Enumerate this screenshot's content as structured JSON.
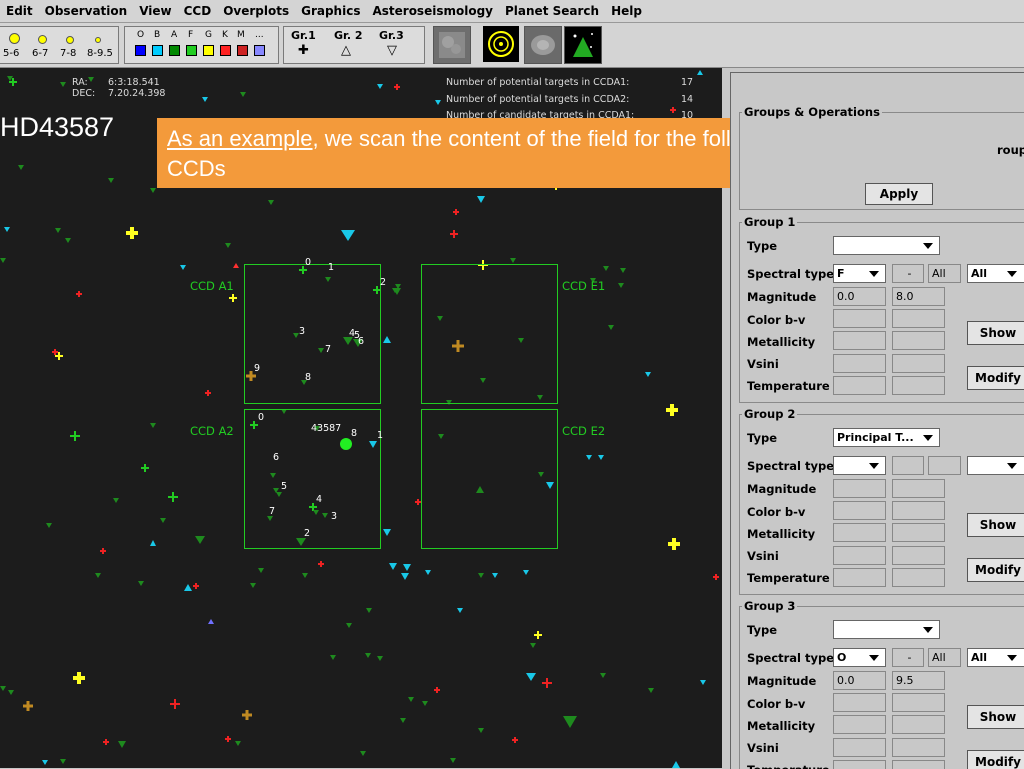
{
  "menubar": {
    "items": [
      "Edit",
      "Observation",
      "View",
      "CCD",
      "Overplots",
      "Graphics",
      "Asteroseismology",
      "Planet Search",
      "Help"
    ]
  },
  "toolbar": {
    "magnitudes": [
      "5-6",
      "6-7",
      "7-8",
      "8-9.5"
    ],
    "spectral_types": [
      "O",
      "B",
      "A",
      "F",
      "G",
      "K",
      "M",
      "..."
    ],
    "spectral_colors": [
      "#0000ff",
      "#00ccff",
      "#00aa00",
      "#22cc22",
      "#ffff00",
      "#ff2222",
      "#cc2222",
      "#8888ff"
    ],
    "groups": [
      {
        "label": "Gr.1",
        "symbol": "✚"
      },
      {
        "label": "Gr. 2",
        "symbol": "△"
      },
      {
        "label": "Gr.3",
        "symbol": "▽"
      }
    ],
    "icons": [
      "sky-image-icon",
      "circle-target-icon",
      "galaxy-icon",
      "star-field-icon"
    ]
  },
  "sky": {
    "ra_label": "RA:",
    "ra_value": "6:3:18.541",
    "dec_label": "DEC:",
    "dec_value": "7.20.24.398",
    "stats": [
      {
        "label": "Number of potential targets in CCDA1:",
        "value": "17"
      },
      {
        "label": "Number of potential targets in CCDA2:",
        "value": "14"
      },
      {
        "label": "Number of candidate targets in CCDA1:",
        "value": "10"
      }
    ],
    "star_name": "HD43587",
    "target_id": "43587",
    "ccds": [
      {
        "id": "a1",
        "label": "CCD A1"
      },
      {
        "id": "a2",
        "label": "CCD A2"
      },
      {
        "id": "e1",
        "label": "CCD E1"
      },
      {
        "id": "e2",
        "label": "CCD E2"
      }
    ],
    "ccd_a1_numbers": [
      "0",
      "1",
      "2",
      "3",
      "4",
      "5",
      "6",
      "7",
      "8",
      "9"
    ],
    "ccd_a2_numbers": [
      "0",
      "1",
      "2",
      "3",
      "4",
      "5",
      "6",
      "7",
      "8"
    ]
  },
  "callout": {
    "link_text": "As an example",
    "rest_text": ", we scan the content of the field for the following position of the CCDs"
  },
  "panel": {
    "groups_ops": {
      "title": "Groups & Operations",
      "group_text": "roup",
      "apply_label": "Apply"
    },
    "labels": {
      "type": "Type",
      "spectral_type": "Spectral type",
      "magnitude": "Magnitude",
      "color": "Color b-v",
      "metallicity": "Metallicity",
      "vsini": "Vsini",
      "temperature": "Temperature",
      "show": "Show",
      "modify": "Modify"
    },
    "group1": {
      "title": "Group 1",
      "type": "",
      "sp_from": "F",
      "sp_dash": "-",
      "sp_all": "All",
      "sp_combo": "All",
      "mag_min": "0.0",
      "mag_max": "8.0"
    },
    "group2": {
      "title": "Group 2",
      "type": "Principal T...",
      "sp_from": "",
      "sp_dash": "",
      "sp_all": "",
      "sp_combo": "",
      "mag_min": "",
      "mag_max": ""
    },
    "group3": {
      "title": "Group 3",
      "type": "",
      "sp_from": "O",
      "sp_dash": "-",
      "sp_all": "All",
      "sp_combo": "All",
      "mag_min": "0.0",
      "mag_max": "9.5"
    }
  }
}
